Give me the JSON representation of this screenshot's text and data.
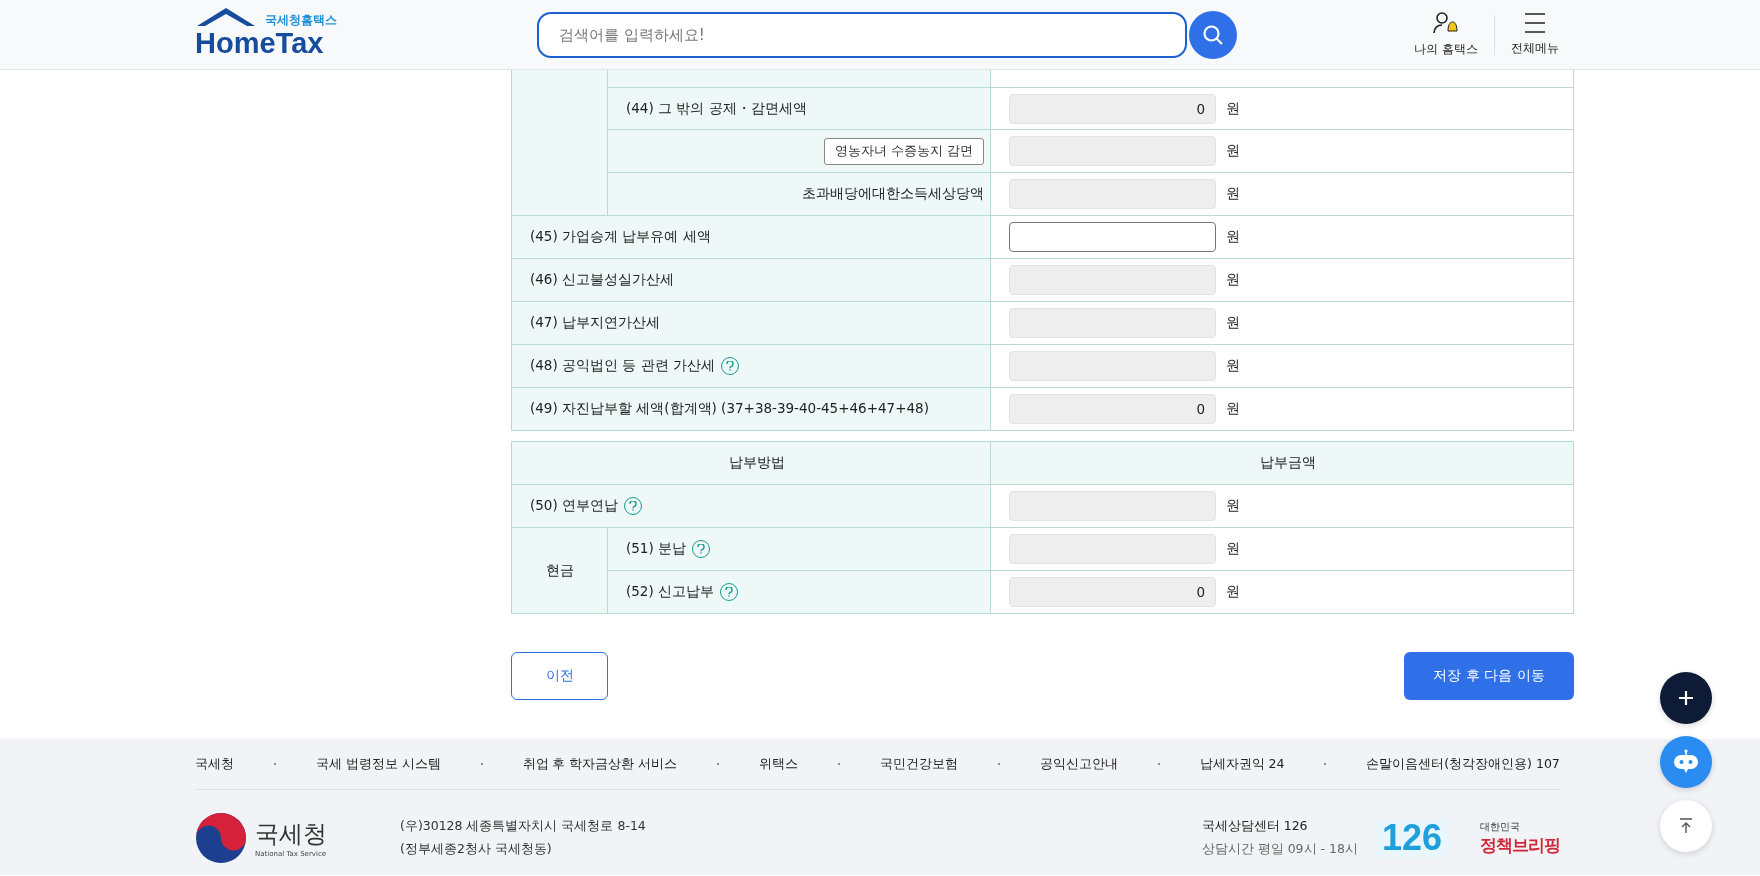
{
  "header": {
    "logo_caption": "국세청홈택스",
    "logo": "HomeTax",
    "search": {
      "placeholder": "검색어를 입력하세요!"
    },
    "nav": [
      {
        "kind": "user",
        "label": "나의 홈택스"
      },
      {
        "kind": "menu",
        "label": "전체메뉴"
      }
    ]
  },
  "tax_table": {
    "group_rows": [
      {
        "kind": "label",
        "label": "(44) 그 밖의 공제・감면세액",
        "editable": false,
        "value": "0",
        "unit": "원"
      },
      {
        "kind": "button",
        "label": "영농자녀 수증농지 감면",
        "editable": false,
        "unit": "원"
      },
      {
        "kind": "right_label",
        "label": "초과배당에대한소득세상당액",
        "editable": false,
        "unit": "원"
      }
    ],
    "rows": [
      {
        "label": "(45) 가업승계 납부유예 세액",
        "editable": true,
        "unit": "원"
      },
      {
        "label": "(46) 신고불성실가산세",
        "editable": false,
        "unit": "원"
      },
      {
        "label": "(47) 납부지연가산세",
        "editable": false,
        "unit": "원"
      },
      {
        "label": "(48) 공익법인 등 관련 가산세",
        "help": true,
        "editable": false,
        "unit": "원"
      },
      {
        "label": "(49) 자진납부할 세액(합계액) (37+38-39-40-45+46+47+48)",
        "editable": false,
        "value": "0",
        "unit": "원"
      }
    ]
  },
  "payment_table": {
    "columns": [
      "납부방법",
      "납부금액"
    ],
    "rows": [
      {
        "label": "(50) 연부연납",
        "help": true,
        "editable": false,
        "unit": "원"
      }
    ],
    "cash_group": {
      "label": "현금",
      "rows": [
        {
          "label": "(51) 분납",
          "help": true,
          "editable": false,
          "unit": "원"
        },
        {
          "label": "(52) 신고납부",
          "help": true,
          "editable": false,
          "value": "0",
          "unit": "원"
        }
      ]
    }
  },
  "prev_button": "이전",
  "next_button": "저장 후 다음 이동",
  "footer": {
    "links": [
      "국세청",
      "국세 법령정보 시스템",
      "취업 후 학자금상환 서비스",
      "위택스",
      "국민건강보험",
      "공익신고안내",
      "납세자권익 24",
      "손말이음센터(청각장애인용) 107"
    ],
    "org_logo": "국세청",
    "org_logo_caption": "National Tax Service",
    "address": [
      "(우)30128 세종특별자치시 국세청로 8-14",
      "(정부세종2청사 국세청동)"
    ],
    "center": "국세상담센터 126",
    "hours": "상담시간 평일 09시 - 18시",
    "call_logo": "126",
    "briefing_caption": "대한민국",
    "briefing_logo": "정책브리핑"
  }
}
